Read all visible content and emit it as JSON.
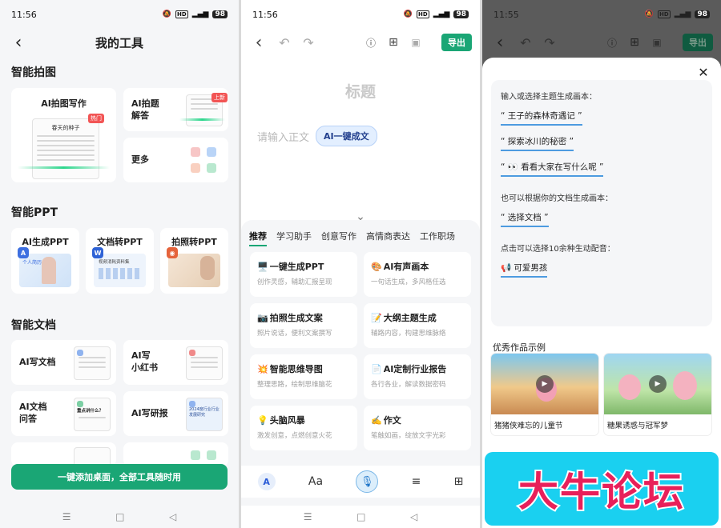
{
  "status": {
    "time": "11:56",
    "battery": "98",
    "hd": "HD",
    "net": "5G"
  },
  "status3": {
    "time": "11:55"
  },
  "tools": {
    "title": "我的工具",
    "section1": "智能拍图",
    "photo_write": "AI拍图写作",
    "hot_badge": "热门",
    "paper_heading": "春天的种子",
    "photo_qa": "AI拍题\n解答",
    "new_badge": "上新",
    "more": "更多",
    "section2": "智能PPT",
    "ppt": [
      "AI生成PPT",
      "文档转PPT",
      "拍照转PPT"
    ],
    "ppt_thumb_texts": [
      "个人简历",
      "视频消耗资料集",
      ""
    ],
    "section3": "智能文档",
    "docs": [
      "AI写文档",
      "AI写\n小红书",
      "AI文档\n问答",
      "AI写研报"
    ],
    "doc_thumb_texts": [
      "",
      "",
      "重点讲什么？",
      "2024度行业行业发展研究"
    ],
    "bottom_button": "一键添加桌面，全部工具随时用"
  },
  "editor": {
    "export": "导出",
    "title_placeholder": "标题",
    "body_placeholder": "请输入正文",
    "ai_pill": "AI一键成文",
    "tabs": [
      "推荐",
      "学习助手",
      "创意写作",
      "高情商表达",
      "工作职场"
    ],
    "functions": [
      {
        "emoji": "🖥️",
        "title": "一键生成PPT",
        "desc": "创作灵感，辅助汇报呈现"
      },
      {
        "emoji": "🎨",
        "title": "AI有声画本",
        "desc": "一句话生成，多风格任选"
      },
      {
        "emoji": "📷",
        "title": "拍照生成文案",
        "desc": "照片说话，便利文案撰写"
      },
      {
        "emoji": "📝",
        "title": "大纲主题生成",
        "desc": "辅路内容，构建思维脉络"
      },
      {
        "emoji": "💥",
        "title": "智能思维导图",
        "desc": "整理思路，绘制思维脑花"
      },
      {
        "emoji": "📄",
        "title": "AI定制行业报告",
        "desc": "各行各业，解读数据密码"
      },
      {
        "emoji": "💡",
        "title": "头脑风暴",
        "desc": "激发创意，点燃创意火花"
      },
      {
        "emoji": "✍️",
        "title": "作文",
        "desc": "笔触如画，绽放文字光彩"
      }
    ],
    "format_bar": {
      "font": "Aa"
    }
  },
  "picturebook": {
    "prompt_head": "输入或选择主题生成画本：",
    "themes": [
      "“ 王子的森林奇遇记 ”",
      "“ 探索冰川的秘密 ”",
      "“ 👀 看看大家在写什么呢 ”"
    ],
    "doc_head": "也可以根据你的文档生成画本：",
    "doc_chip": "“ 选择文档 ”",
    "voice_head": "点击可以选择10余种生动配音：",
    "voice_chip": "📢 可爱男孩",
    "examples_title": "优秀作品示例",
    "examples": [
      "猪猪侠难忘的儿童节",
      "糖果诱惑与冠军梦"
    ]
  },
  "watermark": "大牛论坛"
}
